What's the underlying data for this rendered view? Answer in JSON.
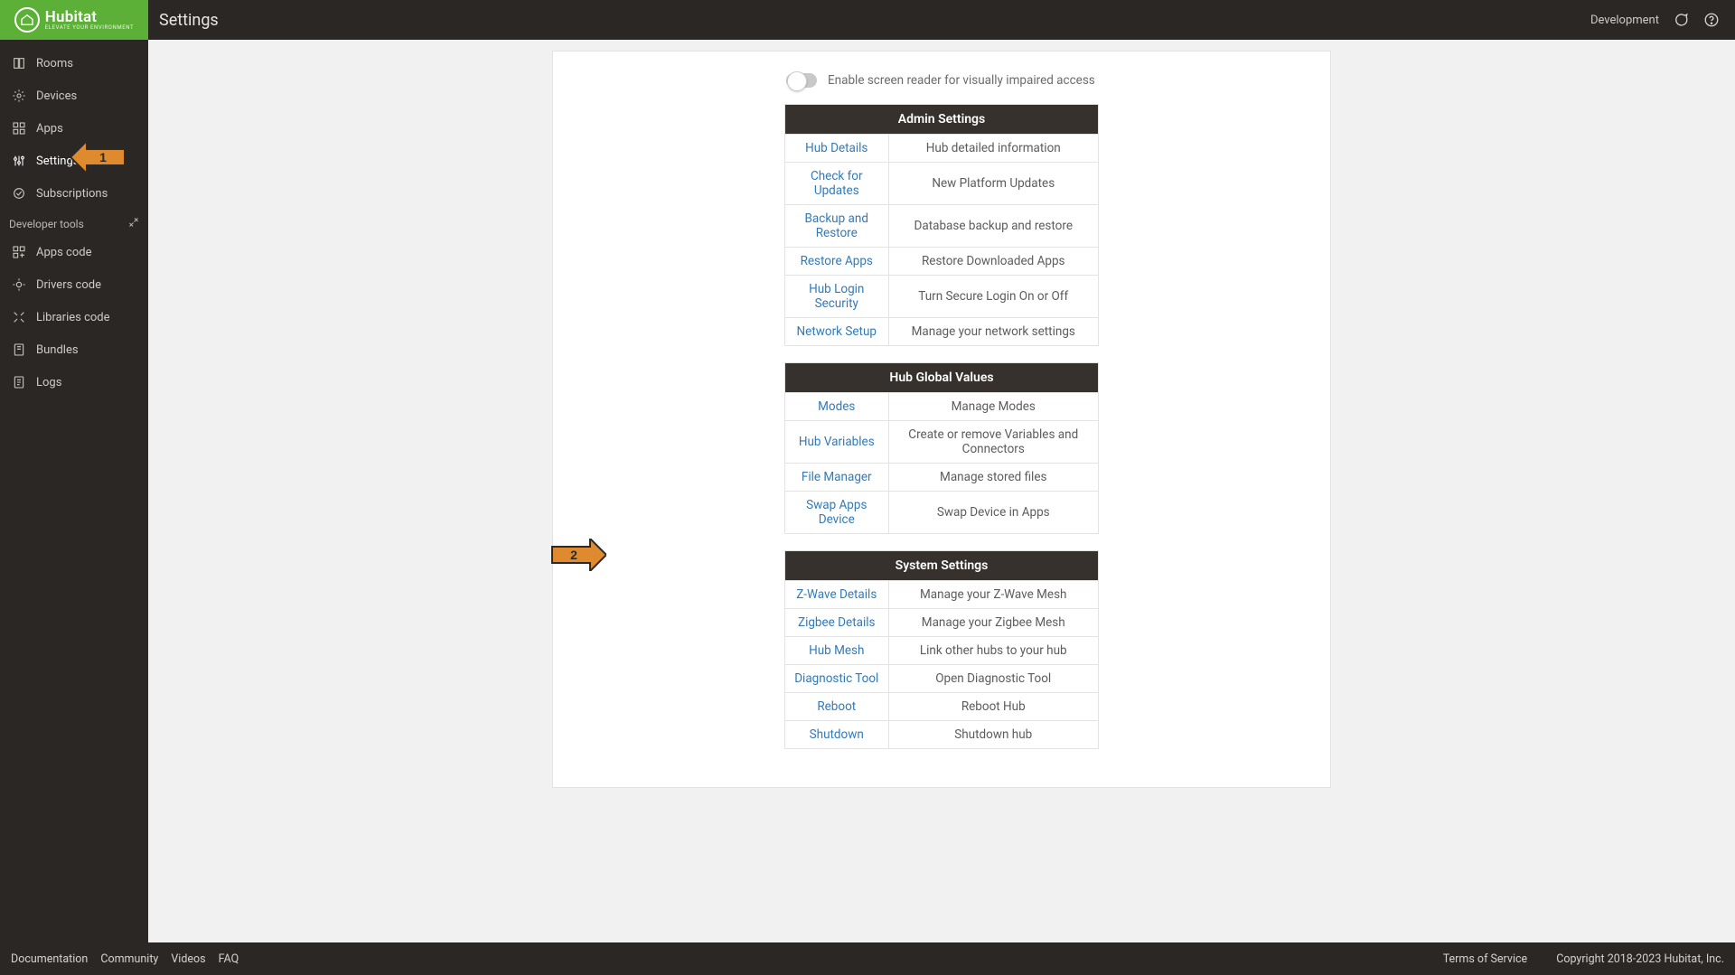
{
  "header": {
    "logo_name": "Hubitat",
    "logo_tagline": "ELEVATE YOUR ENVIRONMENT",
    "page_title": "Settings",
    "right_label": "Development"
  },
  "sidebar": {
    "items": [
      {
        "name": "rooms",
        "label": "Rooms"
      },
      {
        "name": "devices",
        "label": "Devices"
      },
      {
        "name": "apps",
        "label": "Apps"
      },
      {
        "name": "settings",
        "label": "Settings"
      },
      {
        "name": "subscriptions",
        "label": "Subscriptions"
      }
    ],
    "dev_header": "Developer tools",
    "dev_items": [
      {
        "name": "apps-code",
        "label": "Apps code"
      },
      {
        "name": "drivers-code",
        "label": "Drivers code"
      },
      {
        "name": "libraries-code",
        "label": "Libraries code"
      },
      {
        "name": "bundles",
        "label": "Bundles"
      },
      {
        "name": "logs",
        "label": "Logs"
      }
    ]
  },
  "content": {
    "screen_reader_label": "Enable screen reader for visually impaired access",
    "sections": [
      {
        "title": "Admin Settings",
        "rows": [
          {
            "link": "Hub Details",
            "desc": "Hub detailed information"
          },
          {
            "link": "Check for Updates",
            "desc": "New Platform Updates"
          },
          {
            "link": "Backup and Restore",
            "desc": "Database backup and restore"
          },
          {
            "link": "Restore Apps",
            "desc": "Restore Downloaded Apps"
          },
          {
            "link": "Hub Login Security",
            "desc": "Turn Secure Login On or Off"
          },
          {
            "link": "Network Setup",
            "desc": "Manage your network settings"
          }
        ]
      },
      {
        "title": "Hub Global Values",
        "rows": [
          {
            "link": "Modes",
            "desc": "Manage Modes"
          },
          {
            "link": "Hub Variables",
            "desc": "Create or remove Variables and Connectors"
          },
          {
            "link": "File Manager",
            "desc": "Manage stored files"
          },
          {
            "link": "Swap Apps Device",
            "desc": "Swap Device in Apps"
          }
        ]
      },
      {
        "title": "System Settings",
        "rows": [
          {
            "link": "Z-Wave Details",
            "desc": "Manage your Z-Wave Mesh"
          },
          {
            "link": "Zigbee Details",
            "desc": "Manage your Zigbee Mesh"
          },
          {
            "link": "Hub Mesh",
            "desc": "Link other hubs to your hub"
          },
          {
            "link": "Diagnostic Tool",
            "desc": "Open Diagnostic Tool"
          },
          {
            "link": "Reboot",
            "desc": "Reboot Hub"
          },
          {
            "link": "Shutdown",
            "desc": "Shutdown hub"
          }
        ]
      }
    ]
  },
  "footer": {
    "links": [
      "Documentation",
      "Community",
      "Videos",
      "FAQ"
    ],
    "terms": "Terms of Service",
    "copyright": "Copyright 2018-2023 Hubitat, Inc."
  },
  "annotations": {
    "arrow1_text": "1",
    "arrow2_text": "2"
  }
}
